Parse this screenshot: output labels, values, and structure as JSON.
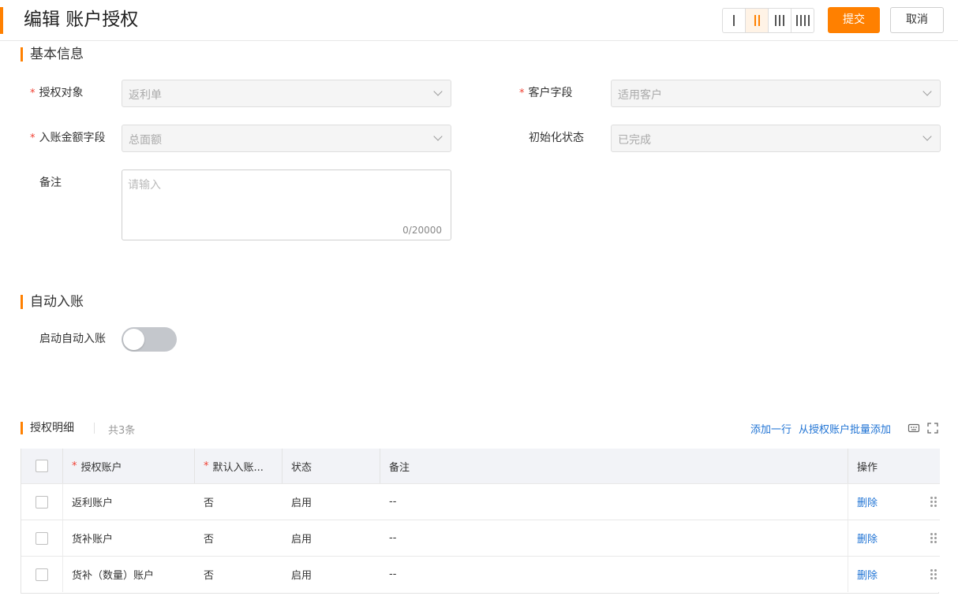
{
  "header": {
    "title": "编辑 账户授权",
    "submit_label": "提交",
    "cancel_label": "取消"
  },
  "basic_info": {
    "title": "基本信息",
    "auth_object": {
      "label": "授权对象",
      "value": "返利单"
    },
    "customer_field": {
      "label": "客户字段",
      "value": "适用客户"
    },
    "amount_field": {
      "label": "入账金额字段",
      "value": "总面额"
    },
    "init_status": {
      "label": "初始化状态",
      "value": "已完成"
    },
    "remark": {
      "label": "备注",
      "placeholder": "请输入",
      "counter": "0/20000"
    }
  },
  "auto_entry": {
    "title": "自动入账",
    "toggle_label": "启动自动入账",
    "enabled": false
  },
  "detail": {
    "title": "授权明细",
    "count": "共3条",
    "add_row": "添加一行",
    "batch_add": "从授权账户批量添加",
    "columns": {
      "account": "授权账户",
      "default_entry": "默认入账...",
      "status": "状态",
      "remark": "备注",
      "operation": "操作"
    },
    "rows": [
      {
        "account": "返利账户",
        "default_entry": "否",
        "status": "启用",
        "remark": "--",
        "action": "删除"
      },
      {
        "account": "货补账户",
        "default_entry": "否",
        "status": "启用",
        "remark": "--",
        "action": "删除"
      },
      {
        "account": "货补（数量）账户",
        "default_entry": "否",
        "status": "启用",
        "remark": "--",
        "action": "删除"
      }
    ]
  },
  "colors": {
    "accent": "#ff8000",
    "link": "#1f73d4",
    "required": "#f04134"
  }
}
